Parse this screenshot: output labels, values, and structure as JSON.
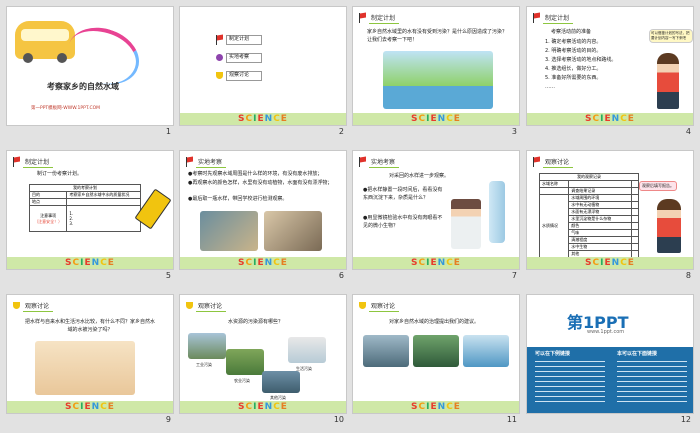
{
  "slides": [
    {
      "number": "1",
      "title": "考察家乡的自然水域",
      "footer_link": "第一PPT模板网-WWW.1PPT.COM"
    },
    {
      "number": "2",
      "agenda": [
        "制定计划",
        "实地考察",
        "观察讨论"
      ]
    },
    {
      "number": "3",
      "header": "制定计划",
      "text": "家乡自然水域里的水有没有受到污染？是什么原因造成了污染？让我们去考察一下吧！"
    },
    {
      "number": "4",
      "header": "制定计划",
      "text_title": "考察活动前的准备",
      "items": [
        "1. 确定考察活动的内容。",
        "2. 明确考察活动的目的。",
        "3. 选择考察活动的地点和路线。",
        "4. 推选组长，做好分工。",
        "5. 准备好所需要的东西。",
        "……"
      ],
      "bubble": "可以借鉴计划的写法，把要计划内容一写下来吧"
    },
    {
      "number": "5",
      "header": "制定计划",
      "text": "制订一份考察计划。",
      "table_title": "我的考察计划",
      "rows": [
        [
          "目的",
          "考察家乡自然水域中水的质量状况"
        ],
        [
          "地点",
          ""
        ],
        [
          "注意事项",
          ""
        ]
      ],
      "note": "（注意安全！）",
      "note_items": [
        "1.",
        "2.",
        "3."
      ]
    },
    {
      "number": "6",
      "header": "实地考察",
      "lines": [
        "●考察时先观察水域周围是什么样的环境，有没有废水排放；",
        "●再观察水的颜色怎样，水里有没有动植物，水面有没有漂浮物；",
        "●最后取一瓶水样，带回学校进行检测观察。"
      ]
    },
    {
      "number": "7",
      "header": "实地考察",
      "text_title": "对采回的水样进一步观察。",
      "lines": [
        "●把水样静置一段时间后，看看没有东西沉淀下来，杂质是什么？",
        "●用显微镜检验水中有没有肉眼看不见的微小生物？"
      ]
    },
    {
      "number": "8",
      "header": "观察讨论",
      "table_title": "我的观察记录",
      "bubble": "观察后填写报告。",
      "cols": [
        "水域名称",
        "",
        "调查结果记录",
        "现场"
      ],
      "rows": [
        "水域周围的环境",
        "水中有无动植物",
        "水面有无漂浮物",
        "水里沉淀物是什么杂物",
        "颜色",
        "气味",
        "清澈程度",
        "水中生物",
        "其他"
      ],
      "row_head": "水质情况"
    },
    {
      "number": "9",
      "header": "观察讨论",
      "text": "把水样与自来水和生活污水比较，有什么不同？家乡自然水域的水被污染了吗？"
    },
    {
      "number": "10",
      "header": "观察讨论",
      "text": "水资源的污染源有哪些？",
      "labels": [
        "工业污染",
        "农业污染",
        "生活污染",
        "其他污染"
      ]
    },
    {
      "number": "11",
      "header": "观察讨论",
      "text": "对家乡自然水域的治理提出我们的建议。"
    },
    {
      "number": "12",
      "logo": "第1PPT",
      "logo_sub": "www.1ppt.com",
      "left_title": "可以在下例链接",
      "right_title": "本可以在下面链接",
      "body": "……"
    }
  ],
  "science_word": "SCIENCE",
  "science_colors": [
    "#e83c2c",
    "#f39c12",
    "#27ae60",
    "#e83c2c",
    "#3498db",
    "#f1c40f",
    "#e67e22"
  ]
}
